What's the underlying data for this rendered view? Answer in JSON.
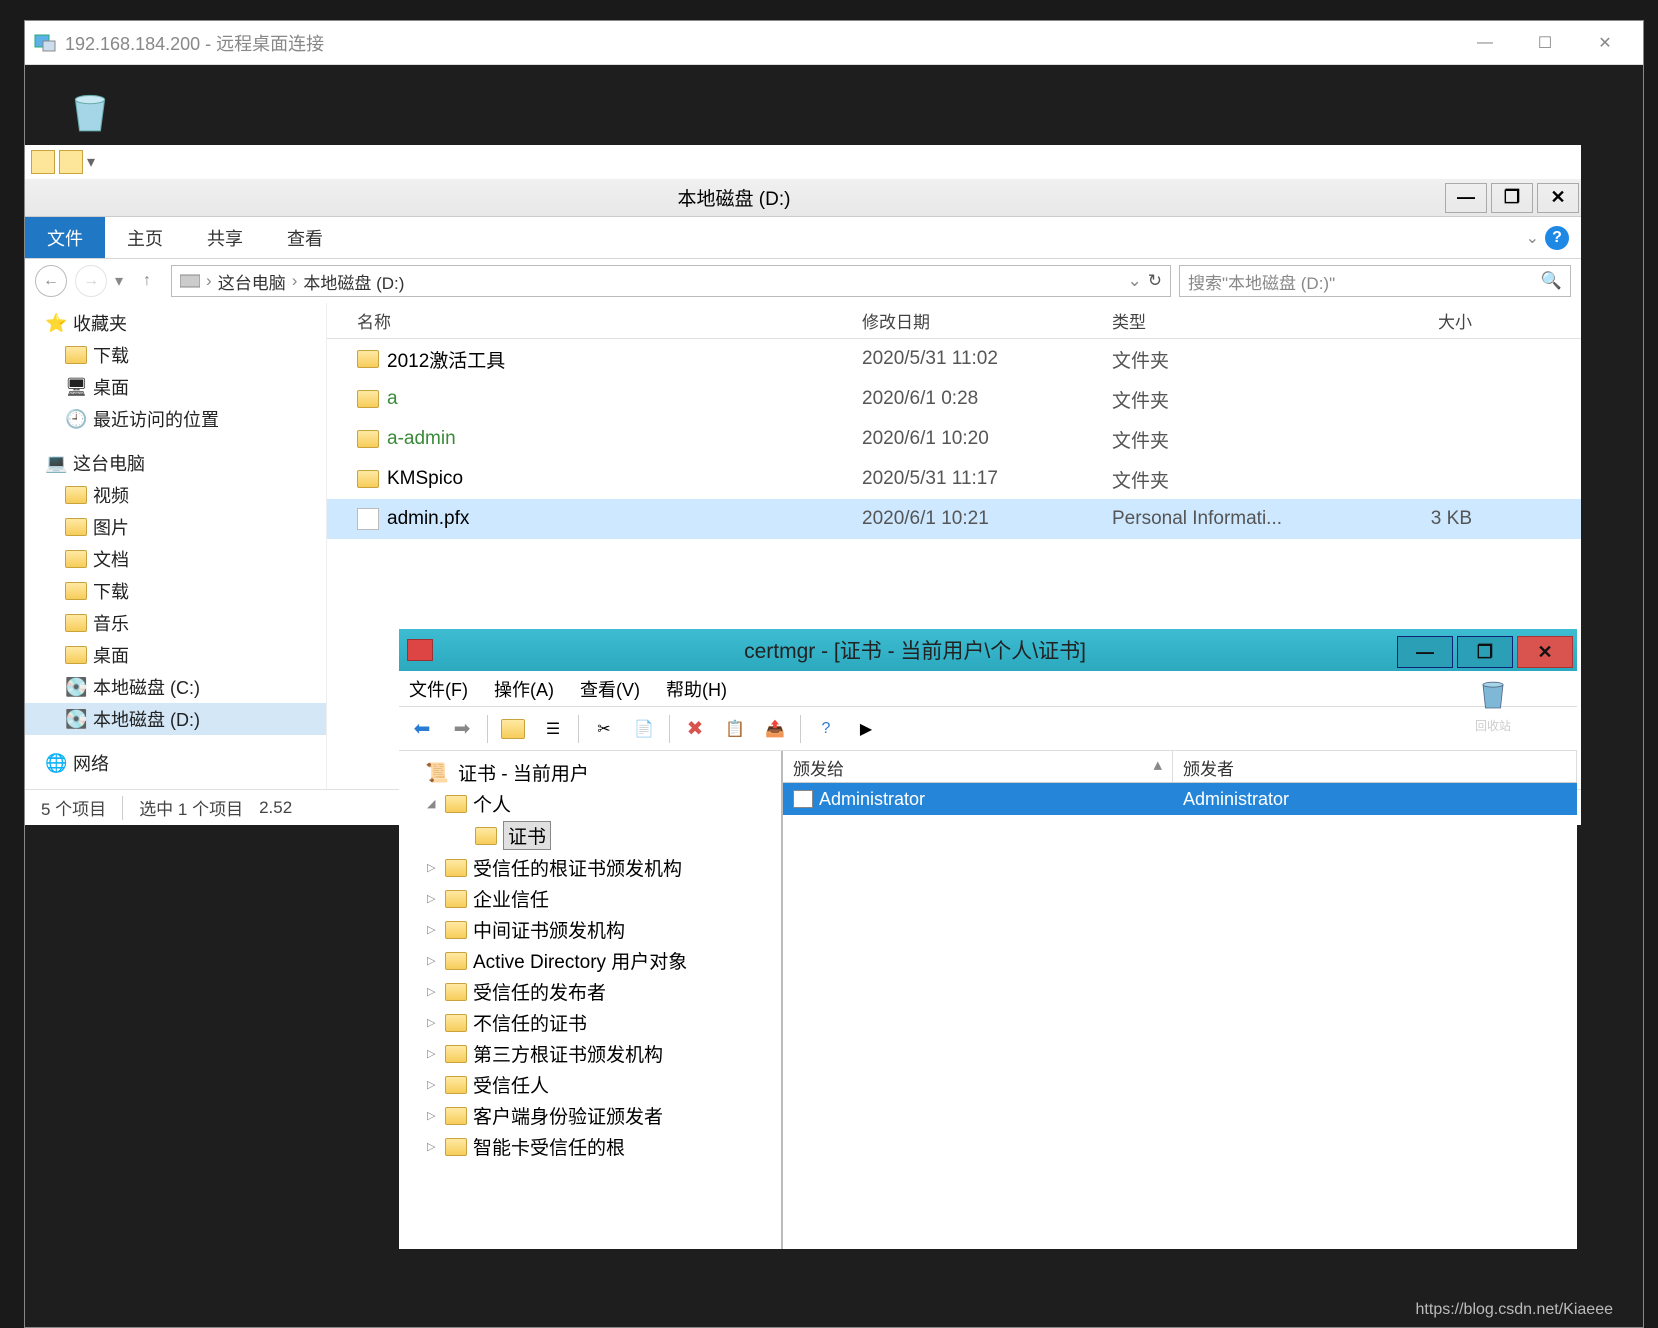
{
  "rdp": {
    "title": "192.168.184.200 - 远程桌面连接"
  },
  "explorer": {
    "title": "本地磁盘 (D:)",
    "tabs": {
      "file": "文件",
      "home": "主页",
      "share": "共享",
      "view": "查看"
    },
    "breadcrumb": {
      "pc": "这台电脑",
      "drive": "本地磁盘 (D:)"
    },
    "search_placeholder": "搜索\"本地磁盘 (D:)\"",
    "columns": {
      "name": "名称",
      "date": "修改日期",
      "type": "类型",
      "size": "大小"
    },
    "sidebar": {
      "favorites": "收藏夹",
      "fav_items": [
        "下载",
        "桌面",
        "最近访问的位置"
      ],
      "this_pc": "这台电脑",
      "pc_items": [
        "视频",
        "图片",
        "文档",
        "下载",
        "音乐",
        "桌面",
        "本地磁盘 (C:)",
        "本地磁盘 (D:)"
      ],
      "network": "网络"
    },
    "files": [
      {
        "name": "2012激活工具",
        "date": "2020/5/31 11:02",
        "type": "文件夹",
        "size": "",
        "icon": "folder",
        "green": false
      },
      {
        "name": "a",
        "date": "2020/6/1 0:28",
        "type": "文件夹",
        "size": "",
        "icon": "folder",
        "green": true
      },
      {
        "name": "a-admin",
        "date": "2020/6/1 10:20",
        "type": "文件夹",
        "size": "",
        "icon": "folder",
        "green": true
      },
      {
        "name": "KMSpico",
        "date": "2020/5/31 11:17",
        "type": "文件夹",
        "size": "",
        "icon": "folder",
        "green": false
      },
      {
        "name": "admin.pfx",
        "date": "2020/6/1 10:21",
        "type": "Personal Informati...",
        "size": "3 KB",
        "icon": "cert",
        "green": false,
        "selected": true
      }
    ],
    "status": {
      "items": "5 个项目",
      "selected": "选中 1 个项目",
      "size": "2.52"
    }
  },
  "certmgr": {
    "title": "certmgr - [证书 - 当前用户\\个人\\证书]",
    "menus": [
      "文件(F)",
      "操作(A)",
      "查看(V)",
      "帮助(H)"
    ],
    "tree": {
      "root": "证书 - 当前用户",
      "personal": "个人",
      "certs": "证书",
      "others": [
        "受信任的根证书颁发机构",
        "企业信任",
        "中间证书颁发机构",
        "Active Directory 用户对象",
        "受信任的发布者",
        "不信任的证书",
        "第三方根证书颁发机构",
        "受信任人",
        "客户端身份验证颁发者",
        "智能卡受信任的根"
      ]
    },
    "list": {
      "col_issued": "颁发给",
      "col_issuer": "颁发者",
      "rows": [
        {
          "issued": "Administrator",
          "issuer": "Administrator"
        }
      ]
    }
  },
  "recycle_label": "回收站",
  "watermark": "https://blog.csdn.net/Kiaeee"
}
